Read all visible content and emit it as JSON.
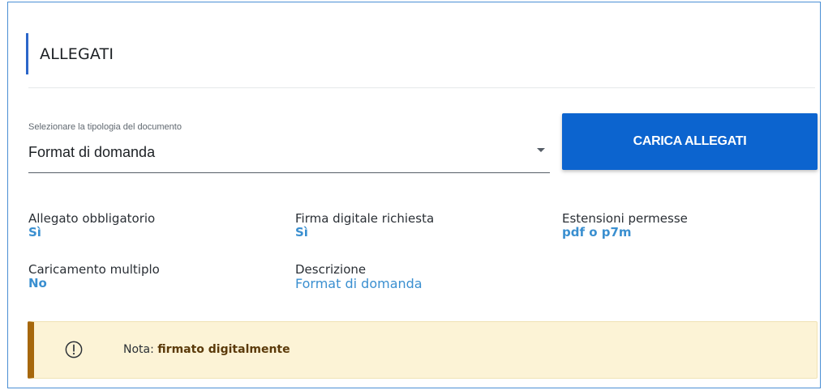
{
  "section": {
    "title": "ALLEGATI"
  },
  "document_select": {
    "label": "Selezionare la tipologia del documento",
    "value": "Format di domanda"
  },
  "upload_button": {
    "label": "CARICA ALLEGATI"
  },
  "details": {
    "required": {
      "label": "Allegato obbligatorio",
      "value": "Sì"
    },
    "signature": {
      "label": "Firma digitale richiesta",
      "value": "Sì"
    },
    "extensions": {
      "label": "Estensioni permesse",
      "value": "pdf o p7m"
    },
    "multiple": {
      "label": "Caricamento multiplo",
      "value": "No"
    },
    "description": {
      "label": "Descrizione",
      "value": "Format di domanda"
    }
  },
  "note": {
    "icon": "exclamation-circle-icon",
    "prefix": "Nota: ",
    "text": "firmato digitalmente"
  },
  "colors": {
    "accent": "#0c64cf",
    "value_text": "#3a8fd0",
    "note_bg": "#fcf3d6",
    "note_border": "#a6670c"
  }
}
